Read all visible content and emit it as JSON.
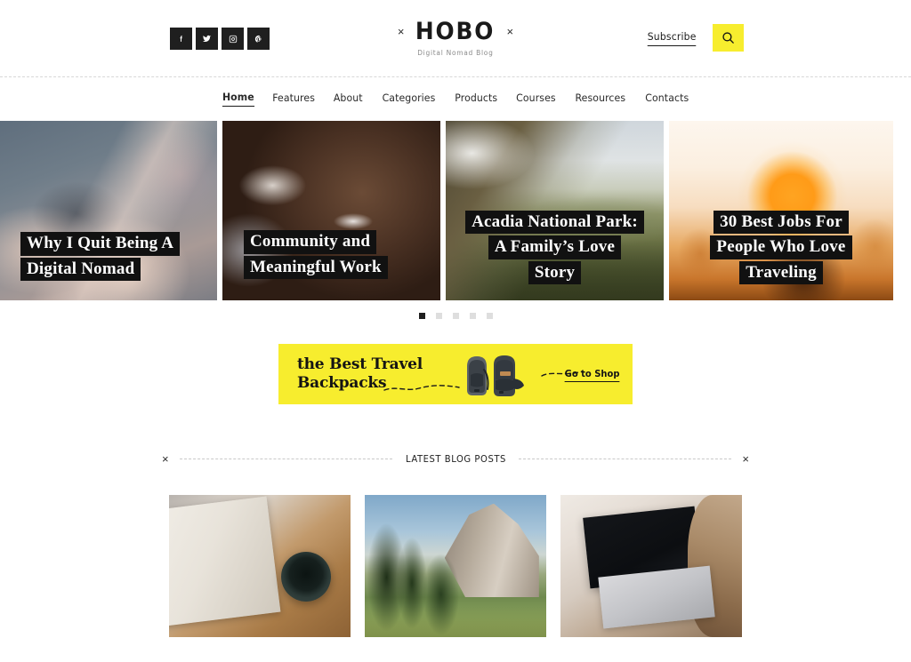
{
  "header": {
    "social": [
      {
        "name": "facebook",
        "glyph": "f"
      },
      {
        "name": "twitter",
        "glyph": "t"
      },
      {
        "name": "instagram",
        "glyph": "i"
      },
      {
        "name": "pinterest",
        "glyph": "p"
      }
    ],
    "logo": {
      "text": "HOBO",
      "subtitle": "Digital Nomad Blog",
      "ornament_left": "×",
      "ornament_right": "×"
    },
    "subscribe_label": "Subscribe",
    "search_icon": "search-icon"
  },
  "nav": {
    "items": [
      {
        "label": "Home",
        "active": true
      },
      {
        "label": "Features",
        "active": false
      },
      {
        "label": "About",
        "active": false
      },
      {
        "label": "Categories",
        "active": false
      },
      {
        "label": "Products",
        "active": false
      },
      {
        "label": "Courses",
        "active": false
      },
      {
        "label": "Resources",
        "active": false
      },
      {
        "label": "Contacts",
        "active": false
      }
    ]
  },
  "hero": {
    "slides": [
      {
        "image": "hands-typing-desk",
        "lines": [
          "Why I Quit Being A",
          "Digital Nomad"
        ],
        "align": "left"
      },
      {
        "image": "smiling-woman-portrait",
        "lines": [
          "Community and",
          "Meaningful Work"
        ],
        "align": "left"
      },
      {
        "image": "mountain-valley-hiker",
        "lines": [
          "Acadia National Park:",
          "A Family’s Love",
          "Story"
        ],
        "align": "center"
      },
      {
        "image": "sunset-silhouette",
        "lines": [
          "30 Best Jobs For",
          "People Who Love",
          "Traveling"
        ],
        "align": "center"
      }
    ],
    "dots": [
      {
        "active": true
      },
      {
        "active": false
      },
      {
        "active": false
      },
      {
        "active": false
      },
      {
        "active": false
      }
    ]
  },
  "promo": {
    "title_line1": "the Best Travel",
    "title_line2": "Backpacks",
    "cta_label": "Go to Shop",
    "background_color": "#f7ed2e",
    "image": "two-backpacks"
  },
  "latest": {
    "section_title": "LATEST BLOG POSTS",
    "ornament_left": "×",
    "ornament_right": "×",
    "posts": [
      {
        "image": "open-book-and-coffee-mug"
      },
      {
        "image": "yosemite-valley-trees"
      },
      {
        "image": "laptop-on-desk-woman"
      }
    ]
  },
  "colors": {
    "accent_yellow": "#f7ed2e",
    "text_dark": "#1a1a1a",
    "page_background": "#ffffff"
  }
}
